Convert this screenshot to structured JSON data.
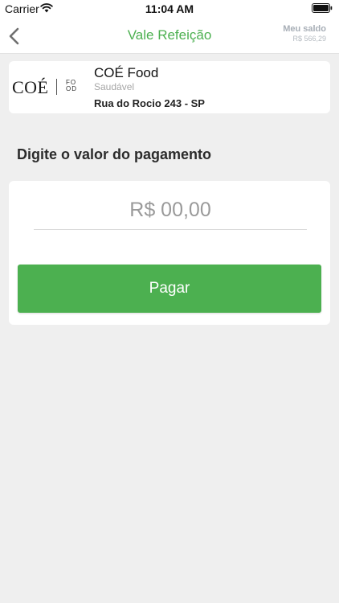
{
  "status_bar": {
    "carrier": "Carrier",
    "time": "11:04 AM"
  },
  "nav": {
    "title": "Vale Refeição",
    "balance_label": "Meu saldo",
    "balance_value": "R$ 566,29"
  },
  "merchant": {
    "logo_text": "COÉ",
    "logo_subtext": "FOOD",
    "name": "COÉ Food",
    "category": "Saudável",
    "address": "Rua do Rocio 243 - SP"
  },
  "payment": {
    "heading": "Digite o valor do pagamento",
    "amount_placeholder": "R$ 00,00",
    "amount_value": "",
    "pay_label": "Pagar"
  },
  "colors": {
    "accent": "#4cb050",
    "background": "#efefef",
    "card": "#ffffff",
    "muted_text": "#a6a6a6"
  },
  "icons": {
    "back": "chevron-left-icon",
    "wifi": "wifi-icon",
    "battery": "battery-icon"
  }
}
